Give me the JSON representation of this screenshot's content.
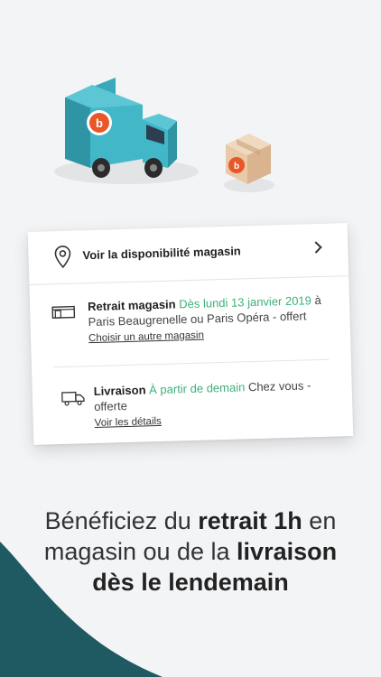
{
  "card": {
    "availability_label": "Voir la disponibilité magasin",
    "retrait": {
      "title": "Retrait magasin",
      "date": "Dès lundi 13 janvier 2019",
      "rest": "à Paris Beaugrenelle ou Paris Opéra - offert",
      "link": "Choisir un autre magasin"
    },
    "livraison": {
      "title": "Livraison",
      "date": "À partir de demain",
      "rest": "Chez vous - offerte",
      "link": "Voir les détails"
    }
  },
  "headline": {
    "part1": "Bénéficiez du ",
    "bold1": "retrait 1h",
    "part2": " en magasin ou de la ",
    "bold2": "livraison",
    "bold3": "dès le lendemain"
  },
  "colors": {
    "accent_green": "#3db07a",
    "truck_teal": "#41b7c8",
    "wave_dark": "#1f5a62",
    "brand_orange": "#e8572a"
  }
}
